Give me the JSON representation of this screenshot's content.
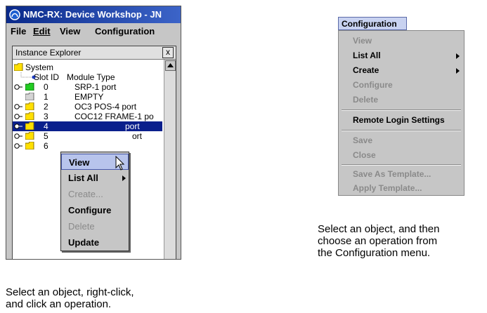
{
  "window": {
    "title": "NMC-RX: Device Workshop - JN"
  },
  "menubar": {
    "items": [
      "File",
      "Edit",
      "View",
      "Configuration"
    ]
  },
  "explorer": {
    "title": "Instance Explorer",
    "close_label": "x",
    "root_label": "System",
    "col_slot": "Slot ID",
    "col_module": "Module Type",
    "rows": [
      {
        "slot": "0",
        "module": "SRP-1 port"
      },
      {
        "slot": "1",
        "module": "EMPTY"
      },
      {
        "slot": "2",
        "module": "OC3 POS-4 port"
      },
      {
        "slot": "3",
        "module": "COC12 FRAME-1 po"
      },
      {
        "slot": "4",
        "module": "port"
      },
      {
        "slot": "5",
        "module": "ort"
      },
      {
        "slot": "6",
        "module": ""
      }
    ],
    "selected_slot": "4"
  },
  "context_menu": {
    "items": [
      {
        "label": "View",
        "state": "highlighted"
      },
      {
        "label": "List All",
        "state": "enabled",
        "submenu": true
      },
      {
        "label": "Create...",
        "state": "disabled"
      },
      {
        "label": "Configure",
        "state": "enabled"
      },
      {
        "label": "Delete",
        "state": "disabled"
      },
      {
        "label": "Update",
        "state": "enabled"
      }
    ]
  },
  "left_caption": [
    "Select an object, right-click,",
    "and click an operation."
  ],
  "config_menu": {
    "title": "Configuration",
    "items": [
      {
        "label": "View",
        "state": "disabled"
      },
      {
        "label": "List All",
        "state": "enabled",
        "submenu": true
      },
      {
        "label": "Create",
        "state": "enabled",
        "submenu": true
      },
      {
        "label": "Configure",
        "state": "disabled"
      },
      {
        "label": "Delete",
        "state": "disabled"
      },
      {
        "label": "Remote Login Settings",
        "state": "enabled"
      },
      {
        "label": "Save",
        "state": "disabled"
      },
      {
        "label": "Close",
        "state": "disabled"
      },
      {
        "label": "Save As Template...",
        "state": "disabled"
      },
      {
        "label": "Apply Template...",
        "state": "disabled"
      }
    ]
  },
  "right_caption": [
    "Select an object, and then",
    "choose an operation from",
    "the Configuration menu."
  ],
  "colors": {
    "titlebar_start": "#0a2a8a",
    "titlebar_end": "#3c64c8",
    "selection": "#0a1f8c",
    "menu_bg": "#c6c6c6",
    "menu_title_bg": "#c8d2f0",
    "disabled_text": "#8a8a8a",
    "folder_yellow": "#ffe000",
    "folder_green": "#22cc22"
  }
}
